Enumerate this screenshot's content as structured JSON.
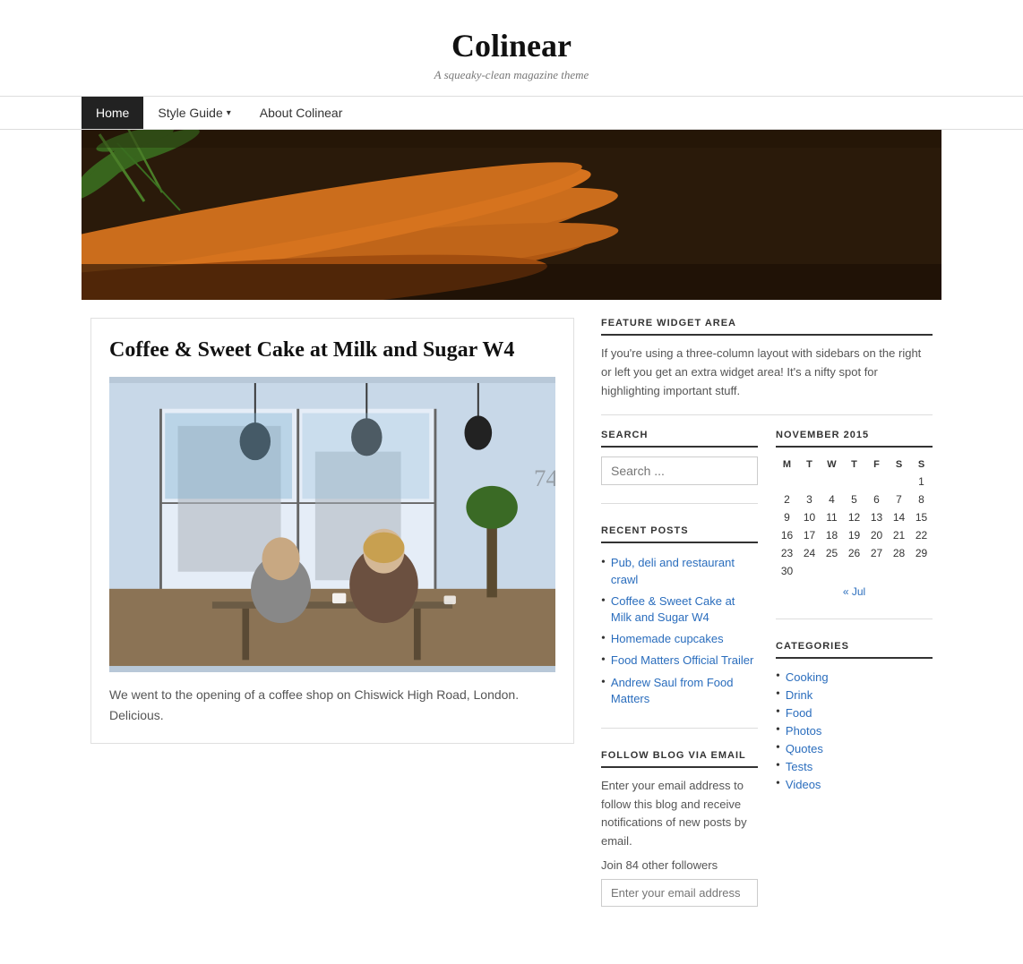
{
  "site": {
    "title": "Colinear",
    "tagline": "A squeaky-clean magazine theme"
  },
  "nav": {
    "items": [
      {
        "label": "Home",
        "active": true
      },
      {
        "label": "Style Guide",
        "hasDropdown": true,
        "active": false
      },
      {
        "label": "About Colinear",
        "active": false
      }
    ]
  },
  "article": {
    "title": "Coffee & Sweet Cake at Milk and Sugar W4",
    "excerpt": "We went to the opening of a coffee shop on Chiswick High Road, London. Delicious."
  },
  "sidebar": {
    "feature": {
      "title": "FEATURE WIDGET AREA",
      "text": "If you're using a three-column layout with sidebars on the right or left you get an extra widget area! It's a nifty spot for highlighting important stuff."
    },
    "search": {
      "title": "SEARCH",
      "placeholder": "Search ..."
    },
    "recent_posts": {
      "title": "RECENT POSTS",
      "items": [
        "Pub, deli and restaurant crawl",
        "Coffee & Sweet Cake at Milk and Sugar W4",
        "Homemade cupcakes",
        "Food Matters Official Trailer",
        "Andrew Saul from Food Matters"
      ]
    },
    "calendar": {
      "title": "NOVEMBER 2015",
      "days_header": [
        "M",
        "T",
        "W",
        "T",
        "F",
        "S",
        "S"
      ],
      "weeks": [
        [
          "",
          "",
          "",
          "",
          "",
          "",
          "1"
        ],
        [
          "2",
          "3",
          "4",
          "5",
          "6",
          "7",
          "8"
        ],
        [
          "9",
          "10",
          "11",
          "12",
          "13",
          "14",
          "15"
        ],
        [
          "16",
          "17",
          "18",
          "19",
          "20",
          "21",
          "22"
        ],
        [
          "23",
          "24",
          "25",
          "26",
          "27",
          "28",
          "29"
        ],
        [
          "30",
          "",
          "",
          "",
          "",
          "",
          ""
        ]
      ],
      "prev_link": "« Jul"
    },
    "follow": {
      "title": "FOLLOW BLOG VIA EMAIL",
      "text": "Enter your email address to follow this blog and receive notifications of new posts by email.",
      "followers": "Join 84 other followers",
      "email_placeholder": "Enter your email address"
    },
    "categories": {
      "title": "CATEGORIES",
      "items": [
        "Cooking",
        "Drink",
        "Food",
        "Photos",
        "Quotes",
        "Tests",
        "Videos"
      ]
    }
  }
}
